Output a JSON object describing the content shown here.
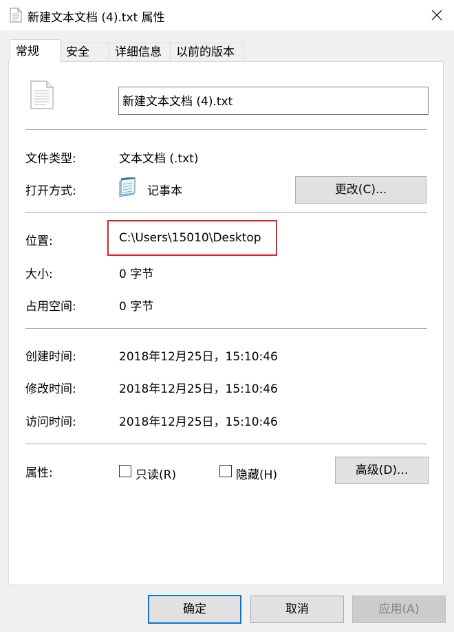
{
  "window": {
    "title": "新建文本文档 (4).txt 属性",
    "icon": "text-file-icon"
  },
  "tabs": [
    {
      "label": "常规",
      "active": true
    },
    {
      "label": "安全",
      "active": false
    },
    {
      "label": "详细信息",
      "active": false
    },
    {
      "label": "以前的版本",
      "active": false
    }
  ],
  "general": {
    "file_icon": "document-icon",
    "filename": "新建文本文档 (4).txt",
    "file_type_label": "文件类型:",
    "file_type_value": "文本文档 (.txt)",
    "open_with_label": "打开方式:",
    "open_with_app": "记事本",
    "open_with_icon": "notepad-icon",
    "change_button": "更改(C)...",
    "location_label": "位置:",
    "location_value": "C:\\Users\\15010\\Desktop",
    "size_label": "大小:",
    "size_value": "0 字节",
    "size_on_disk_label": "占用空间:",
    "size_on_disk_value": "0 字节",
    "created_label": "创建时间:",
    "created_value": "2018年12月25日，15:10:46",
    "modified_label": "修改时间:",
    "modified_value": "2018年12月25日，15:10:46",
    "accessed_label": "访问时间:",
    "accessed_value": "2018年12月25日，15:10:46",
    "attributes_label": "属性:",
    "readonly_label": "只读(R)",
    "readonly_checked": false,
    "hidden_label": "隐藏(H)",
    "hidden_checked": false,
    "advanced_button": "高级(D)..."
  },
  "footer": {
    "ok_button": "确定",
    "cancel_button": "取消",
    "apply_button": "应用(A)"
  },
  "colors": {
    "highlight_border": "#e0202a",
    "default_button_border": "#0078d7",
    "dialog_bg": "#f0f0f0"
  }
}
